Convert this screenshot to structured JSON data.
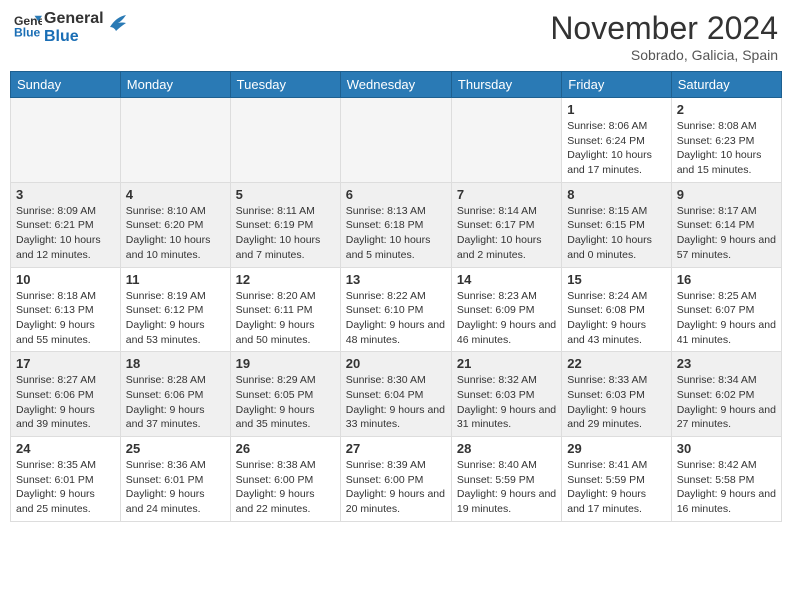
{
  "header": {
    "logo_line1": "General",
    "logo_line2": "Blue",
    "month_title": "November 2024",
    "location": "Sobrado, Galicia, Spain"
  },
  "weekdays": [
    "Sunday",
    "Monday",
    "Tuesday",
    "Wednesday",
    "Thursday",
    "Friday",
    "Saturday"
  ],
  "weeks": [
    [
      {
        "day": "",
        "info": ""
      },
      {
        "day": "",
        "info": ""
      },
      {
        "day": "",
        "info": ""
      },
      {
        "day": "",
        "info": ""
      },
      {
        "day": "",
        "info": ""
      },
      {
        "day": "1",
        "info": "Sunrise: 8:06 AM\nSunset: 6:24 PM\nDaylight: 10 hours and 17 minutes."
      },
      {
        "day": "2",
        "info": "Sunrise: 8:08 AM\nSunset: 6:23 PM\nDaylight: 10 hours and 15 minutes."
      }
    ],
    [
      {
        "day": "3",
        "info": "Sunrise: 8:09 AM\nSunset: 6:21 PM\nDaylight: 10 hours and 12 minutes."
      },
      {
        "day": "4",
        "info": "Sunrise: 8:10 AM\nSunset: 6:20 PM\nDaylight: 10 hours and 10 minutes."
      },
      {
        "day": "5",
        "info": "Sunrise: 8:11 AM\nSunset: 6:19 PM\nDaylight: 10 hours and 7 minutes."
      },
      {
        "day": "6",
        "info": "Sunrise: 8:13 AM\nSunset: 6:18 PM\nDaylight: 10 hours and 5 minutes."
      },
      {
        "day": "7",
        "info": "Sunrise: 8:14 AM\nSunset: 6:17 PM\nDaylight: 10 hours and 2 minutes."
      },
      {
        "day": "8",
        "info": "Sunrise: 8:15 AM\nSunset: 6:15 PM\nDaylight: 10 hours and 0 minutes."
      },
      {
        "day": "9",
        "info": "Sunrise: 8:17 AM\nSunset: 6:14 PM\nDaylight: 9 hours and 57 minutes."
      }
    ],
    [
      {
        "day": "10",
        "info": "Sunrise: 8:18 AM\nSunset: 6:13 PM\nDaylight: 9 hours and 55 minutes."
      },
      {
        "day": "11",
        "info": "Sunrise: 8:19 AM\nSunset: 6:12 PM\nDaylight: 9 hours and 53 minutes."
      },
      {
        "day": "12",
        "info": "Sunrise: 8:20 AM\nSunset: 6:11 PM\nDaylight: 9 hours and 50 minutes."
      },
      {
        "day": "13",
        "info": "Sunrise: 8:22 AM\nSunset: 6:10 PM\nDaylight: 9 hours and 48 minutes."
      },
      {
        "day": "14",
        "info": "Sunrise: 8:23 AM\nSunset: 6:09 PM\nDaylight: 9 hours and 46 minutes."
      },
      {
        "day": "15",
        "info": "Sunrise: 8:24 AM\nSunset: 6:08 PM\nDaylight: 9 hours and 43 minutes."
      },
      {
        "day": "16",
        "info": "Sunrise: 8:25 AM\nSunset: 6:07 PM\nDaylight: 9 hours and 41 minutes."
      }
    ],
    [
      {
        "day": "17",
        "info": "Sunrise: 8:27 AM\nSunset: 6:06 PM\nDaylight: 9 hours and 39 minutes."
      },
      {
        "day": "18",
        "info": "Sunrise: 8:28 AM\nSunset: 6:06 PM\nDaylight: 9 hours and 37 minutes."
      },
      {
        "day": "19",
        "info": "Sunrise: 8:29 AM\nSunset: 6:05 PM\nDaylight: 9 hours and 35 minutes."
      },
      {
        "day": "20",
        "info": "Sunrise: 8:30 AM\nSunset: 6:04 PM\nDaylight: 9 hours and 33 minutes."
      },
      {
        "day": "21",
        "info": "Sunrise: 8:32 AM\nSunset: 6:03 PM\nDaylight: 9 hours and 31 minutes."
      },
      {
        "day": "22",
        "info": "Sunrise: 8:33 AM\nSunset: 6:03 PM\nDaylight: 9 hours and 29 minutes."
      },
      {
        "day": "23",
        "info": "Sunrise: 8:34 AM\nSunset: 6:02 PM\nDaylight: 9 hours and 27 minutes."
      }
    ],
    [
      {
        "day": "24",
        "info": "Sunrise: 8:35 AM\nSunset: 6:01 PM\nDaylight: 9 hours and 25 minutes."
      },
      {
        "day": "25",
        "info": "Sunrise: 8:36 AM\nSunset: 6:01 PM\nDaylight: 9 hours and 24 minutes."
      },
      {
        "day": "26",
        "info": "Sunrise: 8:38 AM\nSunset: 6:00 PM\nDaylight: 9 hours and 22 minutes."
      },
      {
        "day": "27",
        "info": "Sunrise: 8:39 AM\nSunset: 6:00 PM\nDaylight: 9 hours and 20 minutes."
      },
      {
        "day": "28",
        "info": "Sunrise: 8:40 AM\nSunset: 5:59 PM\nDaylight: 9 hours and 19 minutes."
      },
      {
        "day": "29",
        "info": "Sunrise: 8:41 AM\nSunset: 5:59 PM\nDaylight: 9 hours and 17 minutes."
      },
      {
        "day": "30",
        "info": "Sunrise: 8:42 AM\nSunset: 5:58 PM\nDaylight: 9 hours and 16 minutes."
      }
    ]
  ]
}
